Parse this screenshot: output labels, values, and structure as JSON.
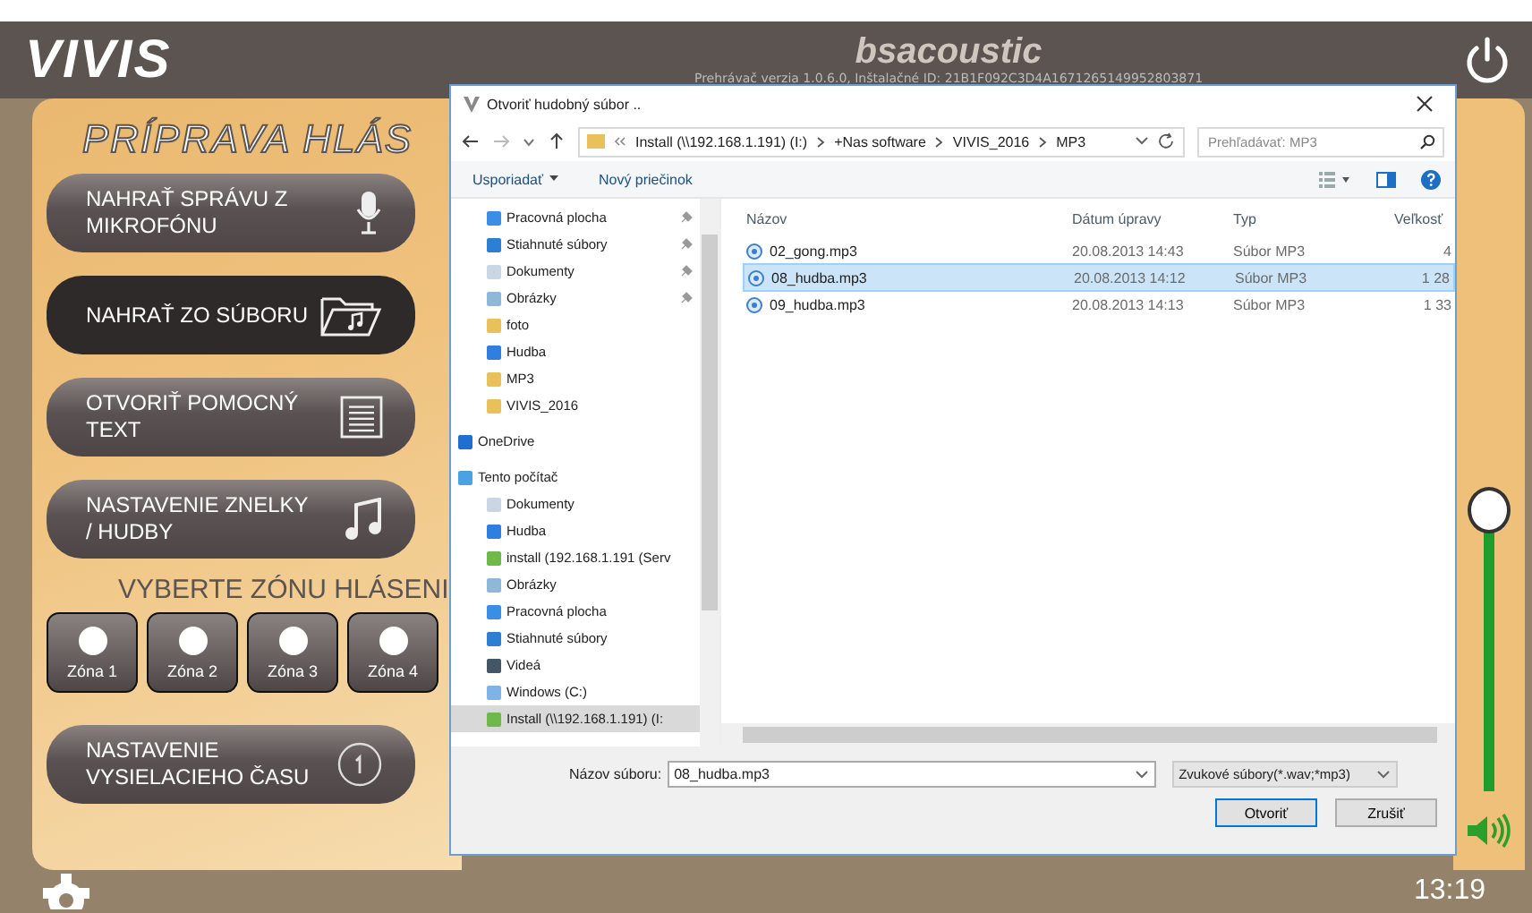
{
  "app": {
    "logo": "VIVIS",
    "brand": "bsacoustic",
    "version": "Prehrávač verzia 1.0.6.0, Inštalačné ID: 21B1F092C3D4A1671265149952803871",
    "title": "PRÍPRAVA HLÁS",
    "zone_heading": "VYBERTE ZÓNU HLÁSENI",
    "time": "13:19"
  },
  "actions": [
    {
      "label": "NAHRAŤ SPRÁVU Z MIKROFÓNU",
      "kind": "mic",
      "selected": false
    },
    {
      "label": "NAHRAŤ ZO SÚBORU",
      "kind": "folder",
      "selected": true
    },
    {
      "label": "OTVORIŤ POMOCNÝ TEXT",
      "kind": "text",
      "selected": false
    },
    {
      "label": "NASTAVENIE ZNELKY / HUDBY",
      "kind": "music",
      "selected": false
    }
  ],
  "zones": [
    {
      "label": "Zóna 1"
    },
    {
      "label": "Zóna 2"
    },
    {
      "label": "Zóna 3"
    },
    {
      "label": "Zóna 4"
    }
  ],
  "schedule_button": {
    "label": "NASTAVENIE VYSIELACIEHO ČASU"
  },
  "volume": {
    "level": 0.95
  },
  "dialog": {
    "title": "Otvoriť hudobný súbor ..",
    "path": [
      "Install (\\\\192.168.1.191) (I:)",
      "+Nas software",
      "VIVIS_2016",
      "MP3"
    ],
    "search": {
      "placeholder": "Prehľadávať: MP3"
    },
    "toolbar": [
      "Usporiadať",
      "Nový priečinok"
    ],
    "nav": [
      {
        "label": "Pracovná plocha",
        "kind": "desktop",
        "pinned": true,
        "selected": false
      },
      {
        "label": "Stiahnuté súbory",
        "kind": "download",
        "pinned": true,
        "selected": false
      },
      {
        "label": "Dokumenty",
        "kind": "doc",
        "pinned": true,
        "selected": false
      },
      {
        "label": "Obrázky",
        "kind": "pictures",
        "pinned": true,
        "selected": false
      },
      {
        "label": "foto",
        "kind": "folder",
        "pinned": false,
        "selected": false
      },
      {
        "label": "Hudba",
        "kind": "music",
        "pinned": false,
        "selected": false
      },
      {
        "label": "MP3",
        "kind": "folder",
        "pinned": false,
        "selected": false
      },
      {
        "label": "VIVIS_2016",
        "kind": "folder",
        "pinned": false,
        "selected": false
      },
      {
        "label": "OneDrive",
        "kind": "cloud",
        "pinned": false,
        "selected": false
      },
      {
        "label": "Tento počítač",
        "kind": "pc",
        "pinned": false,
        "selected": false,
        "children": [
          {
            "label": "Dokumenty",
            "kind": "doc",
            "pinned": false,
            "selected": false
          },
          {
            "label": "Hudba",
            "kind": "music",
            "pinned": false,
            "selected": false
          },
          {
            "label": "install (192.168.1.191 (Serv",
            "kind": "network",
            "pinned": false,
            "selected": false
          },
          {
            "label": "Obrázky",
            "kind": "pictures",
            "pinned": false,
            "selected": false
          },
          {
            "label": "Pracovná plocha",
            "kind": "desktop",
            "pinned": false,
            "selected": false
          },
          {
            "label": "Stiahnuté súbory",
            "kind": "download",
            "pinned": false,
            "selected": false
          },
          {
            "label": "Videá",
            "kind": "video",
            "pinned": false,
            "selected": false
          },
          {
            "label": "Windows (C:)",
            "kind": "drive",
            "pinned": false,
            "selected": false
          },
          {
            "label": "Install (\\\\192.168.1.191) (I:",
            "kind": "network",
            "pinned": false,
            "selected": true
          }
        ]
      }
    ],
    "columns": [
      "Názov",
      "Dátum úpravy",
      "Typ",
      "Veľkosť"
    ],
    "files": [
      {
        "name": "02_gong.mp3",
        "date": "20.08.2013 14:43",
        "type": "Súbor MP3",
        "size": "4",
        "selected": false
      },
      {
        "name": "08_hudba.mp3",
        "date": "20.08.2013 14:12",
        "type": "Súbor MP3",
        "size": "1 28",
        "selected": true
      },
      {
        "name": "09_hudba.mp3",
        "date": "20.08.2013 14:13",
        "type": "Súbor MP3",
        "size": "1 33",
        "selected": false
      }
    ],
    "filename_label": "Názov súboru:",
    "filename": "08_hudba.mp3",
    "filter": "Zvukové súbory(*.wav;*mp3)",
    "buttons": [
      {
        "label": "Otvoriť",
        "kind": "primary"
      },
      {
        "label": "Zrušiť",
        "kind": "secondary"
      }
    ]
  }
}
